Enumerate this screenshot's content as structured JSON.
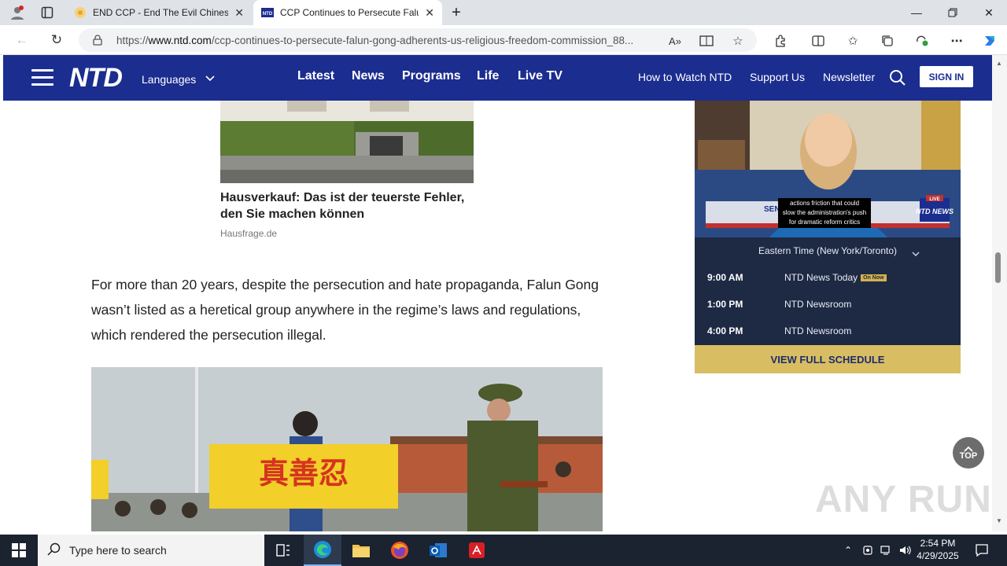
{
  "browser": {
    "tabs": [
      {
        "title": "END CCP - End The Evil Chinese",
        "active": false
      },
      {
        "title": "CCP Continues to Persecute Falu",
        "active": true
      }
    ],
    "url_prefix": "https://",
    "url_host": "www.ntd.com",
    "url_path": "/ccp-continues-to-persecute-falun-gong-adherents-us-religious-freedom-commission_88..."
  },
  "header": {
    "logo": "NTD",
    "languages": "Languages",
    "main_nav": [
      "Latest",
      "News",
      "Programs",
      "Life",
      "Live TV"
    ],
    "secondary_nav": [
      "How to Watch NTD",
      "Support Us",
      "Newsletter"
    ],
    "signin": "SIGN IN"
  },
  "ad": {
    "title": "Hausverkauf: Das ist der teuerste Fehler, den Sie machen können",
    "source": "Hausfrage.de"
  },
  "article": {
    "paragraph": "For more than 20 years, despite the persecution and hate propaganda, Falun Gong wasn’t listed as a heretical group anywhere in the regime’s laws and regulations, which rendered the persecution illegal.",
    "banner_text": "真善忍"
  },
  "sidebar": {
    "video_caption": [
      "actions friction that could",
      "slow the administration's push",
      "for dramatic reform critics"
    ],
    "video_banner_left": "SEN",
    "video_banner_right": "NTD NEWS",
    "video_badge": "LIVE",
    "timezone": "Eastern Time (New York/Toronto)",
    "schedule": [
      {
        "time": "9:00 AM",
        "show": "NTD News Today",
        "badge": "On Now"
      },
      {
        "time": "1:00 PM",
        "show": "NTD Newsroom",
        "badge": ""
      },
      {
        "time": "4:00 PM",
        "show": "NTD Newsroom",
        "badge": ""
      }
    ],
    "full_schedule": "VIEW FULL SCHEDULE"
  },
  "scroll_top": "TOP",
  "watermark": "ANY RUN",
  "taskbar": {
    "search_placeholder": "Type here to search",
    "time": "2:54 PM",
    "date": "4/29/2025"
  }
}
